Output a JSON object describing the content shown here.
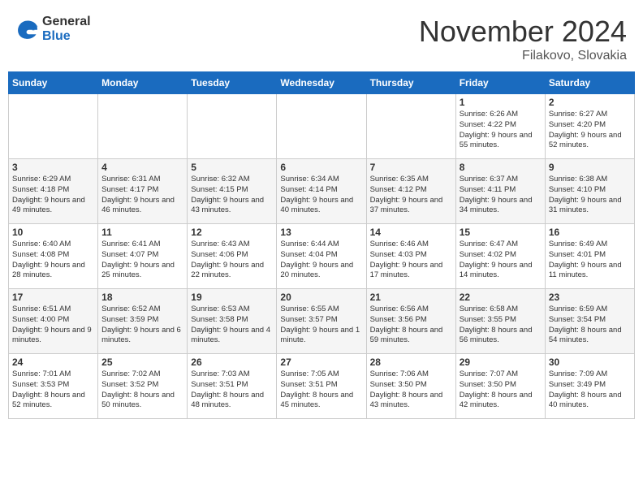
{
  "logo": {
    "general": "General",
    "blue": "Blue"
  },
  "title": "November 2024",
  "location": "Filakovo, Slovakia",
  "days_of_week": [
    "Sunday",
    "Monday",
    "Tuesday",
    "Wednesday",
    "Thursday",
    "Friday",
    "Saturday"
  ],
  "weeks": [
    [
      {
        "day": "",
        "info": ""
      },
      {
        "day": "",
        "info": ""
      },
      {
        "day": "",
        "info": ""
      },
      {
        "day": "",
        "info": ""
      },
      {
        "day": "",
        "info": ""
      },
      {
        "day": "1",
        "info": "Sunrise: 6:26 AM\nSunset: 4:22 PM\nDaylight: 9 hours\nand 55 minutes."
      },
      {
        "day": "2",
        "info": "Sunrise: 6:27 AM\nSunset: 4:20 PM\nDaylight: 9 hours\nand 52 minutes."
      }
    ],
    [
      {
        "day": "3",
        "info": "Sunrise: 6:29 AM\nSunset: 4:18 PM\nDaylight: 9 hours\nand 49 minutes."
      },
      {
        "day": "4",
        "info": "Sunrise: 6:31 AM\nSunset: 4:17 PM\nDaylight: 9 hours\nand 46 minutes."
      },
      {
        "day": "5",
        "info": "Sunrise: 6:32 AM\nSunset: 4:15 PM\nDaylight: 9 hours\nand 43 minutes."
      },
      {
        "day": "6",
        "info": "Sunrise: 6:34 AM\nSunset: 4:14 PM\nDaylight: 9 hours\nand 40 minutes."
      },
      {
        "day": "7",
        "info": "Sunrise: 6:35 AM\nSunset: 4:12 PM\nDaylight: 9 hours\nand 37 minutes."
      },
      {
        "day": "8",
        "info": "Sunrise: 6:37 AM\nSunset: 4:11 PM\nDaylight: 9 hours\nand 34 minutes."
      },
      {
        "day": "9",
        "info": "Sunrise: 6:38 AM\nSunset: 4:10 PM\nDaylight: 9 hours\nand 31 minutes."
      }
    ],
    [
      {
        "day": "10",
        "info": "Sunrise: 6:40 AM\nSunset: 4:08 PM\nDaylight: 9 hours\nand 28 minutes."
      },
      {
        "day": "11",
        "info": "Sunrise: 6:41 AM\nSunset: 4:07 PM\nDaylight: 9 hours\nand 25 minutes."
      },
      {
        "day": "12",
        "info": "Sunrise: 6:43 AM\nSunset: 4:06 PM\nDaylight: 9 hours\nand 22 minutes."
      },
      {
        "day": "13",
        "info": "Sunrise: 6:44 AM\nSunset: 4:04 PM\nDaylight: 9 hours\nand 20 minutes."
      },
      {
        "day": "14",
        "info": "Sunrise: 6:46 AM\nSunset: 4:03 PM\nDaylight: 9 hours\nand 17 minutes."
      },
      {
        "day": "15",
        "info": "Sunrise: 6:47 AM\nSunset: 4:02 PM\nDaylight: 9 hours\nand 14 minutes."
      },
      {
        "day": "16",
        "info": "Sunrise: 6:49 AM\nSunset: 4:01 PM\nDaylight: 9 hours\nand 11 minutes."
      }
    ],
    [
      {
        "day": "17",
        "info": "Sunrise: 6:51 AM\nSunset: 4:00 PM\nDaylight: 9 hours\nand 9 minutes."
      },
      {
        "day": "18",
        "info": "Sunrise: 6:52 AM\nSunset: 3:59 PM\nDaylight: 9 hours\nand 6 minutes."
      },
      {
        "day": "19",
        "info": "Sunrise: 6:53 AM\nSunset: 3:58 PM\nDaylight: 9 hours\nand 4 minutes."
      },
      {
        "day": "20",
        "info": "Sunrise: 6:55 AM\nSunset: 3:57 PM\nDaylight: 9 hours\nand 1 minute."
      },
      {
        "day": "21",
        "info": "Sunrise: 6:56 AM\nSunset: 3:56 PM\nDaylight: 8 hours\nand 59 minutes."
      },
      {
        "day": "22",
        "info": "Sunrise: 6:58 AM\nSunset: 3:55 PM\nDaylight: 8 hours\nand 56 minutes."
      },
      {
        "day": "23",
        "info": "Sunrise: 6:59 AM\nSunset: 3:54 PM\nDaylight: 8 hours\nand 54 minutes."
      }
    ],
    [
      {
        "day": "24",
        "info": "Sunrise: 7:01 AM\nSunset: 3:53 PM\nDaylight: 8 hours\nand 52 minutes."
      },
      {
        "day": "25",
        "info": "Sunrise: 7:02 AM\nSunset: 3:52 PM\nDaylight: 8 hours\nand 50 minutes."
      },
      {
        "day": "26",
        "info": "Sunrise: 7:03 AM\nSunset: 3:51 PM\nDaylight: 8 hours\nand 48 minutes."
      },
      {
        "day": "27",
        "info": "Sunrise: 7:05 AM\nSunset: 3:51 PM\nDaylight: 8 hours\nand 45 minutes."
      },
      {
        "day": "28",
        "info": "Sunrise: 7:06 AM\nSunset: 3:50 PM\nDaylight: 8 hours\nand 43 minutes."
      },
      {
        "day": "29",
        "info": "Sunrise: 7:07 AM\nSunset: 3:50 PM\nDaylight: 8 hours\nand 42 minutes."
      },
      {
        "day": "30",
        "info": "Sunrise: 7:09 AM\nSunset: 3:49 PM\nDaylight: 8 hours\nand 40 minutes."
      }
    ]
  ]
}
